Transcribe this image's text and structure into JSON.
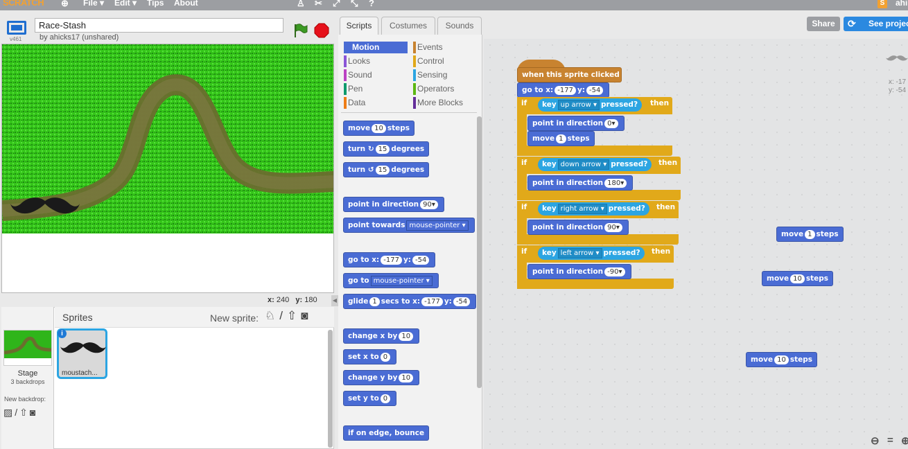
{
  "topbar": {
    "logo": "SCRATCH",
    "menu": [
      "File ▾",
      "Edit ▾",
      "Tips",
      "About"
    ],
    "user_short": "ahi"
  },
  "header_buttons": {
    "share": "Share",
    "see_project": "See projec"
  },
  "project": {
    "title": "Race-Stash",
    "byline": "by ahicks17 (unshared)",
    "version": "v461"
  },
  "stage_coords": {
    "x_label": "x:",
    "x": "240",
    "y_label": "y:",
    "y": "180"
  },
  "tabs": [
    "Scripts",
    "Costumes",
    "Sounds"
  ],
  "categories": [
    {
      "label": "Motion",
      "color": "#4a6cd4"
    },
    {
      "label": "Events",
      "color": "#c88330"
    },
    {
      "label": "Looks",
      "color": "#8a55d7"
    },
    {
      "label": "Control",
      "color": "#e1a91a"
    },
    {
      "label": "Sound",
      "color": "#bb42c3"
    },
    {
      "label": "Sensing",
      "color": "#2ca5e2"
    },
    {
      "label": "Pen",
      "color": "#0e9a6c"
    },
    {
      "label": "Operators",
      "color": "#5cb712"
    },
    {
      "label": "Data",
      "color": "#ee7d16"
    },
    {
      "label": "More Blocks",
      "color": "#632d99"
    }
  ],
  "palette": {
    "move": "move",
    "move_n": "10",
    "steps": "steps",
    "turn": "turn",
    "turn_n": "15",
    "degrees": "degrees",
    "point_dir": "point in direction",
    "point_dir_n": "90▾",
    "point_towards": "point towards",
    "mouse_pointer": "mouse-pointer ▾",
    "goto_xy": "go to x:",
    "x_val": "-177",
    "y_lbl": "y:",
    "y_val": "-54",
    "goto": "go to",
    "glide": "glide",
    "glide_n": "1",
    "secs_to_x": "secs to x:",
    "change_x": "change x by",
    "change_x_n": "10",
    "set_x": "set x to",
    "set_x_n": "0",
    "change_y": "change y by",
    "change_y_n": "10",
    "set_y": "set y to",
    "set_y_n": "0",
    "bounce": "if on edge, bounce"
  },
  "script": {
    "hat": "when this sprite clicked",
    "goto": "go to x:",
    "x": "-177",
    "y_lbl": "y:",
    "y": "-54",
    "if": "if",
    "key": "key",
    "pressed": "pressed?",
    "then": "then",
    "keys": [
      "up arrow ▾",
      "down arrow ▾",
      "right arrow ▾",
      "left arrow ▾"
    ],
    "point_dir": "point in direction",
    "dirs": [
      "0▾",
      "180▾",
      "90▾",
      "-90▾"
    ],
    "move": "move",
    "steps": "steps",
    "move1": "1",
    "move10": "10"
  },
  "sprite_corner": {
    "x": "x: -17",
    "y": "y: -54"
  },
  "sprites": {
    "header": "Sprites",
    "new_sprite": "New sprite:",
    "stage_label": "Stage",
    "backdrops": "3 backdrops",
    "new_backdrop": "New backdrop:",
    "sprite1": "moustach..."
  },
  "zoom": {
    "out": "−",
    "reset": "=",
    "in": "+"
  }
}
